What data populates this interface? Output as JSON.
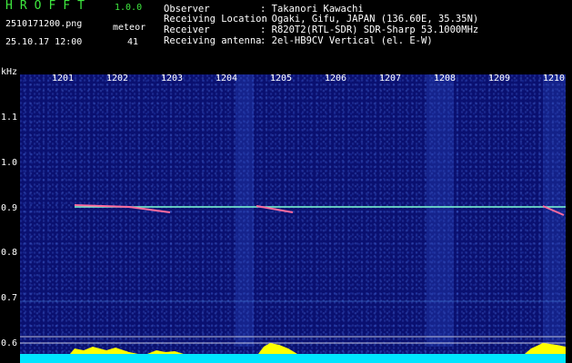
{
  "header": {
    "app_name": "HROFFT",
    "app_version": "1.0.0",
    "file_name": "2510171200.png",
    "meteor_label": "meteor",
    "date_time": "25.10.17 12:00",
    "meteor_count": "41",
    "info": [
      {
        "key": "Observer",
        "value": ": Takanori Kawachi"
      },
      {
        "key": "Receiving Location",
        "value": ": Ogaki, Gifu, JAPAN (136.60E, 35.35N)"
      },
      {
        "key": "Receiver",
        "value": ": R820T2(RTL-SDR) SDR-Sharp 53.1000MHz"
      },
      {
        "key": "Receiving antenna",
        "value": ": 2el-HB9CV Vertical (el. E-W)"
      }
    ]
  },
  "axis": {
    "y_unit": "kHz",
    "y_ticks": [
      "1.1",
      "1.0",
      "0.9",
      "0.8",
      "0.7",
      "0.6"
    ],
    "x_ticks": [
      "1201",
      "1202",
      "1203",
      "1204",
      "1205",
      "1206",
      "1207",
      "1208",
      "1209",
      "1210"
    ]
  },
  "colors": {
    "background": "#000000",
    "plot_noise": "#0a1070",
    "title_green": "#3ee83e",
    "signal": "#7fffd4",
    "histogram_yellow": "#ffff00",
    "histogram_cyan": "#00e5ff"
  }
}
